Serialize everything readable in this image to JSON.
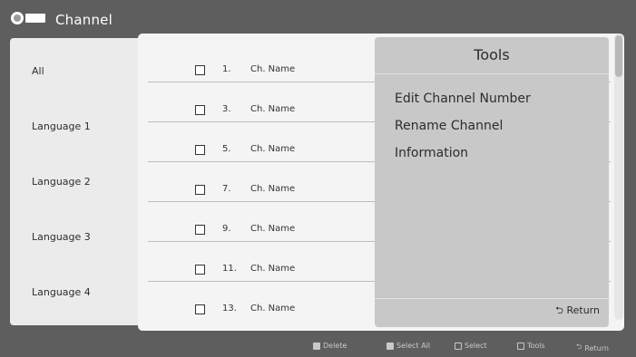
{
  "header": {
    "title": "Channel",
    "icon": "tv-icon"
  },
  "sidebar": {
    "items": [
      {
        "label": "All"
      },
      {
        "label": "Language 1"
      },
      {
        "label": "Language 2"
      },
      {
        "label": "Language 3"
      },
      {
        "label": "Language 4"
      }
    ]
  },
  "channels": [
    {
      "number": "1.",
      "name": "Ch. Name"
    },
    {
      "number": "3.",
      "name": "Ch. Name"
    },
    {
      "number": "5.",
      "name": "Ch. Name"
    },
    {
      "number": "7.",
      "name": "Ch. Name"
    },
    {
      "number": "9.",
      "name": "Ch. Name"
    },
    {
      "number": "11.",
      "name": "Ch. Name"
    },
    {
      "number": "13.",
      "name": "Ch. Name"
    }
  ],
  "tools": {
    "title": "Tools",
    "items": [
      {
        "label": "Edit Channel Number"
      },
      {
        "label": "Rename Channel"
      },
      {
        "label": "Information"
      }
    ],
    "return_label": "Return"
  },
  "footer": {
    "delete": "Delete",
    "select_all": "Select All",
    "select": "Select",
    "tools": "Tools",
    "return": "Return"
  },
  "colors": {
    "background": "#5e5e5e",
    "panel": "#f4f4f4",
    "tools_panel": "#c8c8c8"
  }
}
